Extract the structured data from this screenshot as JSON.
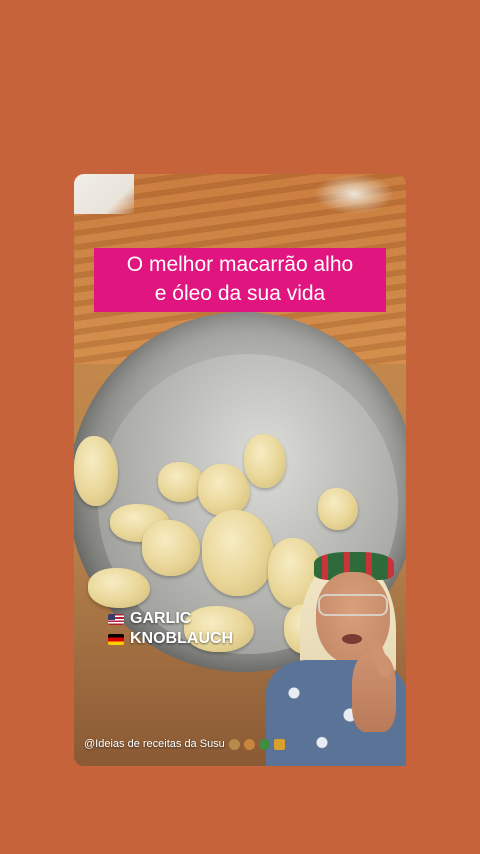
{
  "caption": {
    "line1": "O melhor macarrão alho",
    "line2": "e óleo da sua vida"
  },
  "ingredient_labels": [
    {
      "flag": "us-flag-icon",
      "text": "GARLIC"
    },
    {
      "flag": "de-flag-icon",
      "text": "KNOBLAUCH"
    }
  ],
  "watermark": {
    "text": "@Ideias de receitas da Susu"
  },
  "colors": {
    "background": "#c7633a",
    "caption_bg": "#e0157f",
    "caption_text": "#ffffff"
  }
}
